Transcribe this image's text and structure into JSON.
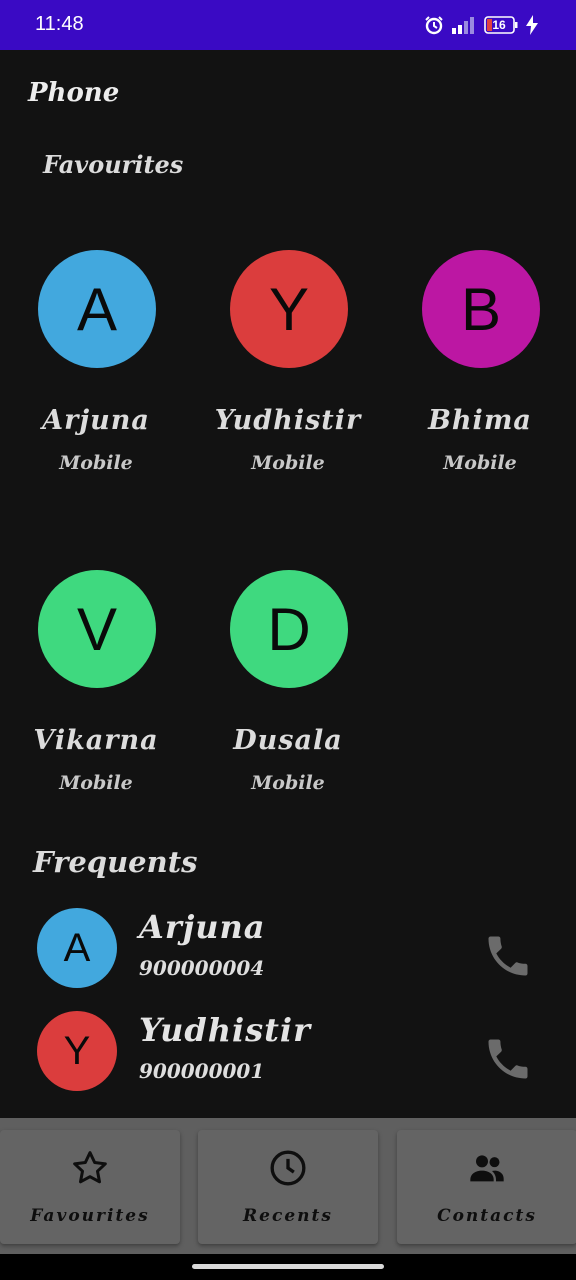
{
  "status_bar": {
    "time": "11:48",
    "battery": "16",
    "icons": [
      "alarm-icon",
      "signal-icon",
      "battery-icon",
      "charging-icon"
    ]
  },
  "header": {
    "title": "Phone"
  },
  "favourites": {
    "title": "Favourites",
    "items": [
      {
        "initial": "A",
        "name": "Arjuna",
        "type": "Mobile",
        "color": "#42a8de"
      },
      {
        "initial": "Y",
        "name": "Yudhistir",
        "type": "Mobile",
        "color": "#db3d3d"
      },
      {
        "initial": "B",
        "name": "Bhima",
        "type": "Mobile",
        "color": "#bc17a3"
      },
      {
        "initial": "V",
        "name": "Vikarna",
        "type": "Mobile",
        "color": "#3fd97f"
      },
      {
        "initial": "D",
        "name": "Dusala",
        "type": "Mobile",
        "color": "#3fd97f"
      }
    ]
  },
  "frequents": {
    "title": "Frequents",
    "items": [
      {
        "initial": "A",
        "name": "Arjuna",
        "number": "900000004",
        "color": "#42a8de",
        "action_icon": "phone-call-icon"
      },
      {
        "initial": "Y",
        "name": "Yudhistir",
        "number": "900000001",
        "color": "#db3d3d",
        "action_icon": "phone-call-icon"
      }
    ]
  },
  "bottom_nav": {
    "tabs": [
      {
        "label": "Favourites",
        "icon": "star-icon"
      },
      {
        "label": "Recents",
        "icon": "clock-icon"
      },
      {
        "label": "Contacts",
        "icon": "people-icon"
      }
    ]
  },
  "colors": {
    "status_bar": "#3a0ac4",
    "background": "#121212",
    "nav_background": "#5f5f5f",
    "call_icon": "#6b6b6b"
  }
}
